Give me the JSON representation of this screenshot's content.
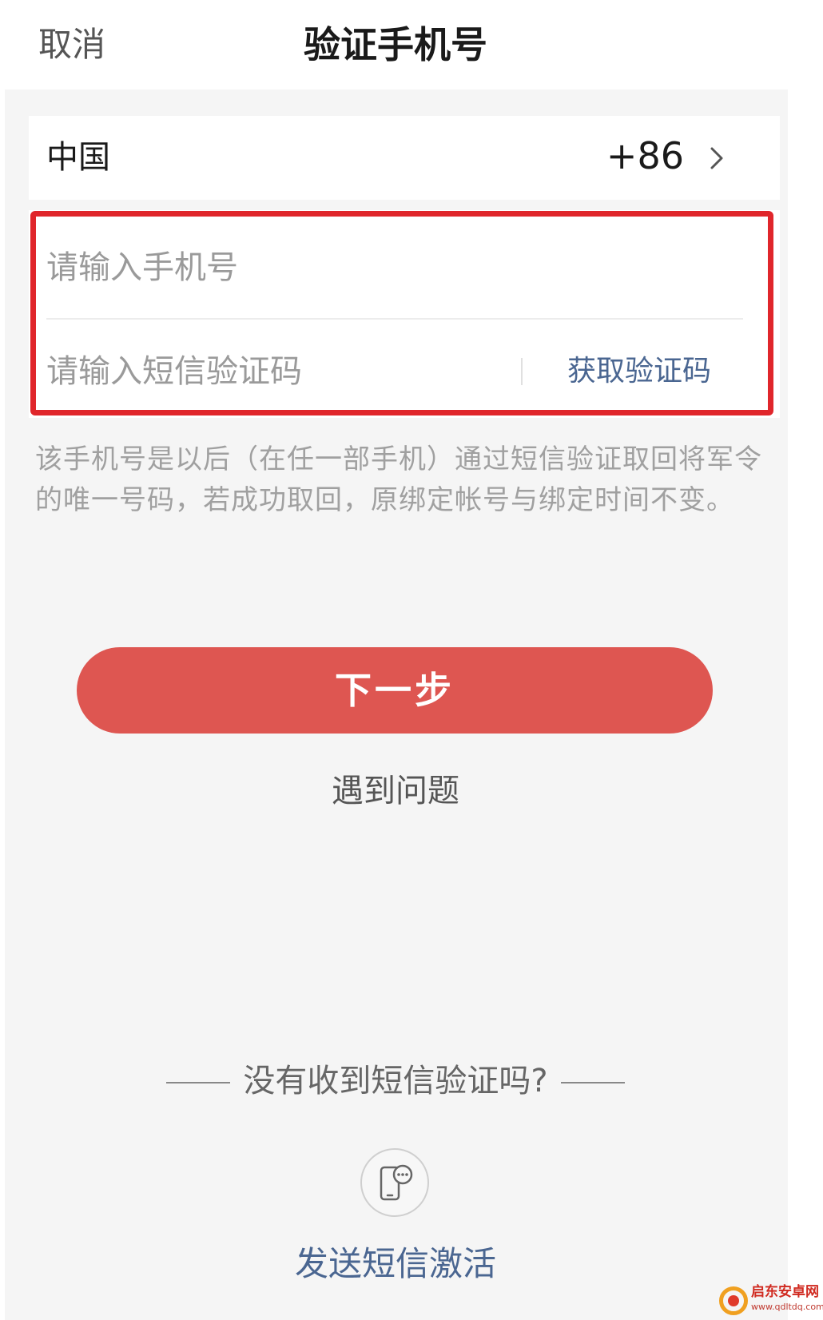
{
  "header": {
    "cancel_label": "取消",
    "title": "验证手机号"
  },
  "country": {
    "name": "中国",
    "code": "+86",
    "icon": "chevron-right-icon"
  },
  "form": {
    "phone_placeholder": "请输入手机号",
    "phone_value": "",
    "code_placeholder": "请输入短信验证码",
    "code_value": "",
    "get_code_label": "获取验证码"
  },
  "notice": "该手机号是以后（在任一部手机）通过短信验证取回将军令的唯一号码，若成功取回，原绑定帐号与绑定时间不变。",
  "actions": {
    "next_label": "下一步",
    "problem_label": "遇到问题"
  },
  "no_sms": {
    "heading": "没有收到短信验证吗?",
    "icon": "sms-phone-icon",
    "send_label": "发送短信激活"
  },
  "watermark": {
    "name": "启东安卓网",
    "url": "www.qdltdq.com"
  },
  "colors": {
    "accent": "#de5651",
    "highlight": "#e0262b",
    "link": "#4a6691",
    "background": "#f5f5f5"
  }
}
